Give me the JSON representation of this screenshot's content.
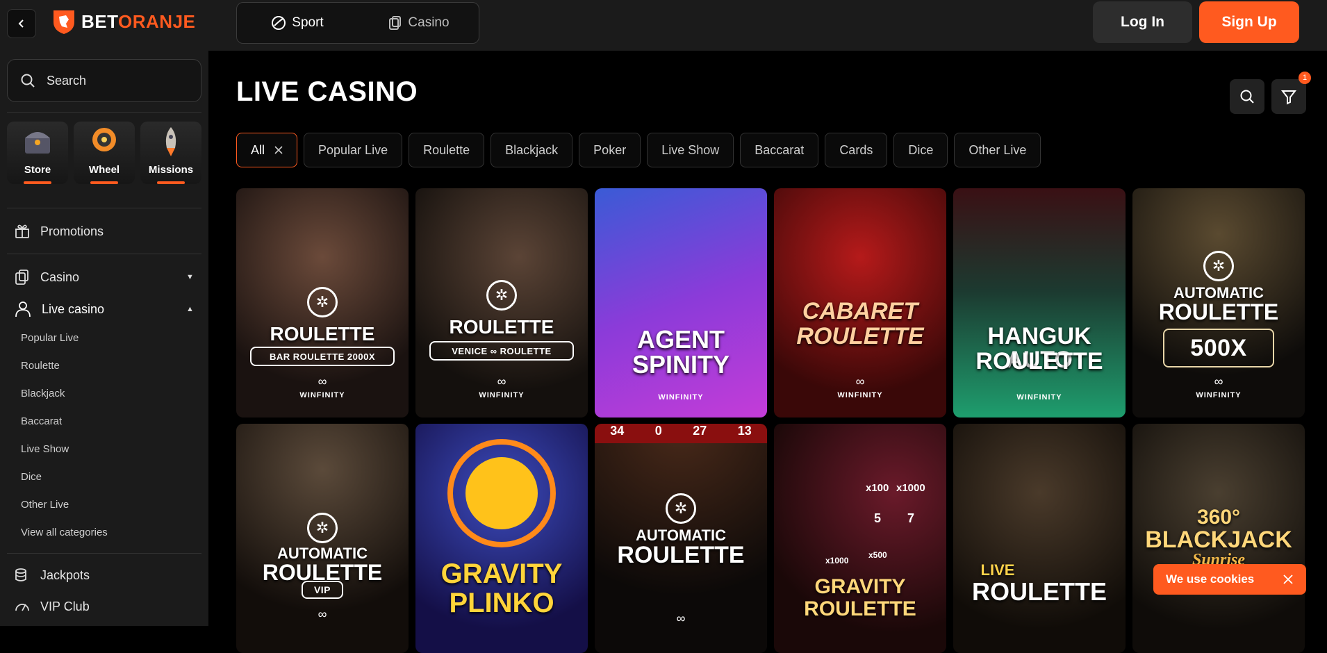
{
  "header": {
    "logo_bet": "BET",
    "logo_oranje": "ORANJE",
    "mode_tabs": [
      {
        "label": "Sport"
      },
      {
        "label": "Casino"
      }
    ],
    "login_label": "Log In",
    "signup_label": "Sign Up"
  },
  "sidebar": {
    "search_placeholder": "Search",
    "tiles": [
      {
        "label": "Store"
      },
      {
        "label": "Wheel"
      },
      {
        "label": "Missions"
      }
    ],
    "promotions": "Promotions",
    "casino": "Casino",
    "live_casino": "Live casino",
    "sub_items": [
      "Popular Live",
      "Roulette",
      "Blackjack",
      "Baccarat",
      "Live Show",
      "Dice",
      "Other Live",
      "View all categories"
    ],
    "jackpots": "Jackpots",
    "vip_club": "VIP Club"
  },
  "main": {
    "title": "LIVE CASINO",
    "filter_count": "1",
    "chips": [
      "All",
      "Popular Live",
      "Roulette",
      "Blackjack",
      "Poker",
      "Live Show",
      "Baccarat",
      "Cards",
      "Dice",
      "Other Live"
    ],
    "games": [
      {
        "title": "ROULETTE",
        "sub": "BAR ROULETTE 2000X",
        "provider": "WINFINITY"
      },
      {
        "title": "ROULETTE",
        "sub": "VENICE ∞ ROULETTE",
        "provider": "WINFINITY"
      },
      {
        "title_line1": "AGENT",
        "title_line2": "SPINITY",
        "provider": "WINFINITY"
      },
      {
        "title_line1": "CABARET",
        "title_line2": "ROULETTE",
        "provider": "WINFINITY"
      },
      {
        "title_line1": "HANGUK AUTO",
        "title_line2": "ROULETTE",
        "provider": "WINFINITY"
      },
      {
        "title_line1": "AUTOMATIC",
        "title_line2": "ROULETTE",
        "sub": "500X",
        "provider": "WINFINITY"
      },
      {
        "title_line1": "AUTOMATIC",
        "title_line2": "ROULETTE",
        "sub": "VIP"
      },
      {
        "title_line1": "GRAVITY",
        "title_line2": "PLINKO"
      },
      {
        "title_line1": "AUTOMATIC",
        "title_line2": "ROULETTE",
        "wheel_numbers": [
          "34",
          "0",
          "27",
          "13"
        ]
      },
      {
        "title_line1": "GRAVITY",
        "title_line2": "ROULETTE",
        "multipliers": [
          "x100",
          "x1000",
          "5",
          "7",
          "x1000",
          "x500"
        ]
      },
      {
        "title_line1": "LIVE",
        "title_line2": "ROULETTE"
      },
      {
        "title_line1": "360°",
        "title_line2": "BLACKJACK",
        "title_line3": "Sunrise"
      }
    ]
  },
  "cookie": {
    "text": "We use cookies"
  },
  "colors": {
    "accent": "#ff5a1f",
    "sidebar_bg": "#1b1b1b",
    "page_bg": "#000000"
  }
}
